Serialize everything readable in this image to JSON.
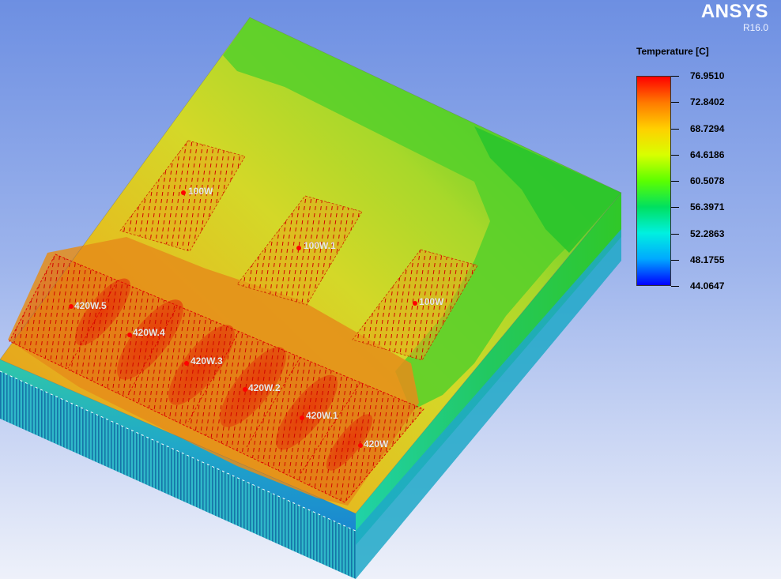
{
  "app": {
    "brand_name": "ANSYS",
    "brand_version": "R16.0"
  },
  "legend": {
    "title": "Temperature [C]",
    "values": [
      "76.9510",
      "72.8402",
      "68.7294",
      "64.6186",
      "60.5078",
      "56.3971",
      "52.2863",
      "48.1755",
      "44.0647"
    ],
    "colors": [
      "#ff0000",
      "#ff7a00",
      "#ffd000",
      "#d8ff00",
      "#5cff00",
      "#00e060",
      "#00f0e0",
      "#00a8ff",
      "#0000ff"
    ]
  },
  "heat_sources": [
    {
      "label": "420W.5"
    },
    {
      "label": "420W.4"
    },
    {
      "label": "420W.3"
    },
    {
      "label": "420W.2"
    },
    {
      "label": "420W.1"
    },
    {
      "label": "420W"
    },
    {
      "label": "100W"
    },
    {
      "label": "100W.1"
    },
    {
      "label": "100W"
    }
  ],
  "colors": {
    "background_top": "#6a8ee0",
    "background_bottom": "#e6ecf8",
    "hot": "#e33a10",
    "warm": "#e6a11a",
    "mild": "#d6d820",
    "cool": "#40cc28"
  }
}
